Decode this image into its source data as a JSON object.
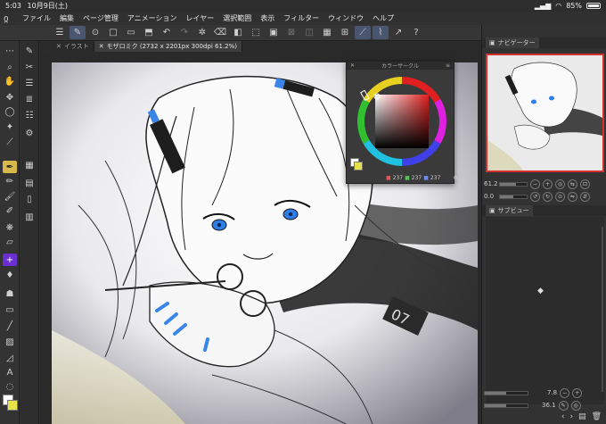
{
  "status": {
    "time": "5:03",
    "date": "10月9日(土)",
    "battery": "85%",
    "battery_level": 0.85
  },
  "menu": {
    "logo_icon": "clip-studio-logo-icon",
    "items": [
      "ファイル",
      "編集",
      "ページ管理",
      "アニメーション",
      "レイヤー",
      "選択範囲",
      "表示",
      "フィルター",
      "ウィンドウ",
      "ヘルプ"
    ]
  },
  "tabs": [
    {
      "label": "イラスト",
      "active": false
    },
    {
      "label": "モザロミク (2732 x 2201px 300dpi 61.2%)",
      "active": true
    }
  ],
  "color_panel": {
    "title": "カラーサークル",
    "r": "237",
    "g": "237",
    "b": "237"
  },
  "right_panel": {
    "navigator_title": "ナビゲーター",
    "zoom": "61.2",
    "rotation": "0.0",
    "zoom_level": 0.61,
    "rotation_level": 0.5,
    "subview_title": "サブビュー",
    "bottom_value_1": "7.8",
    "bottom_value_2": "36.1"
  },
  "colors": {
    "accent": "#d8b84a",
    "selection": "#6b2fd0",
    "navigator_frame": "#d43030",
    "panel_bg": "#323232"
  }
}
